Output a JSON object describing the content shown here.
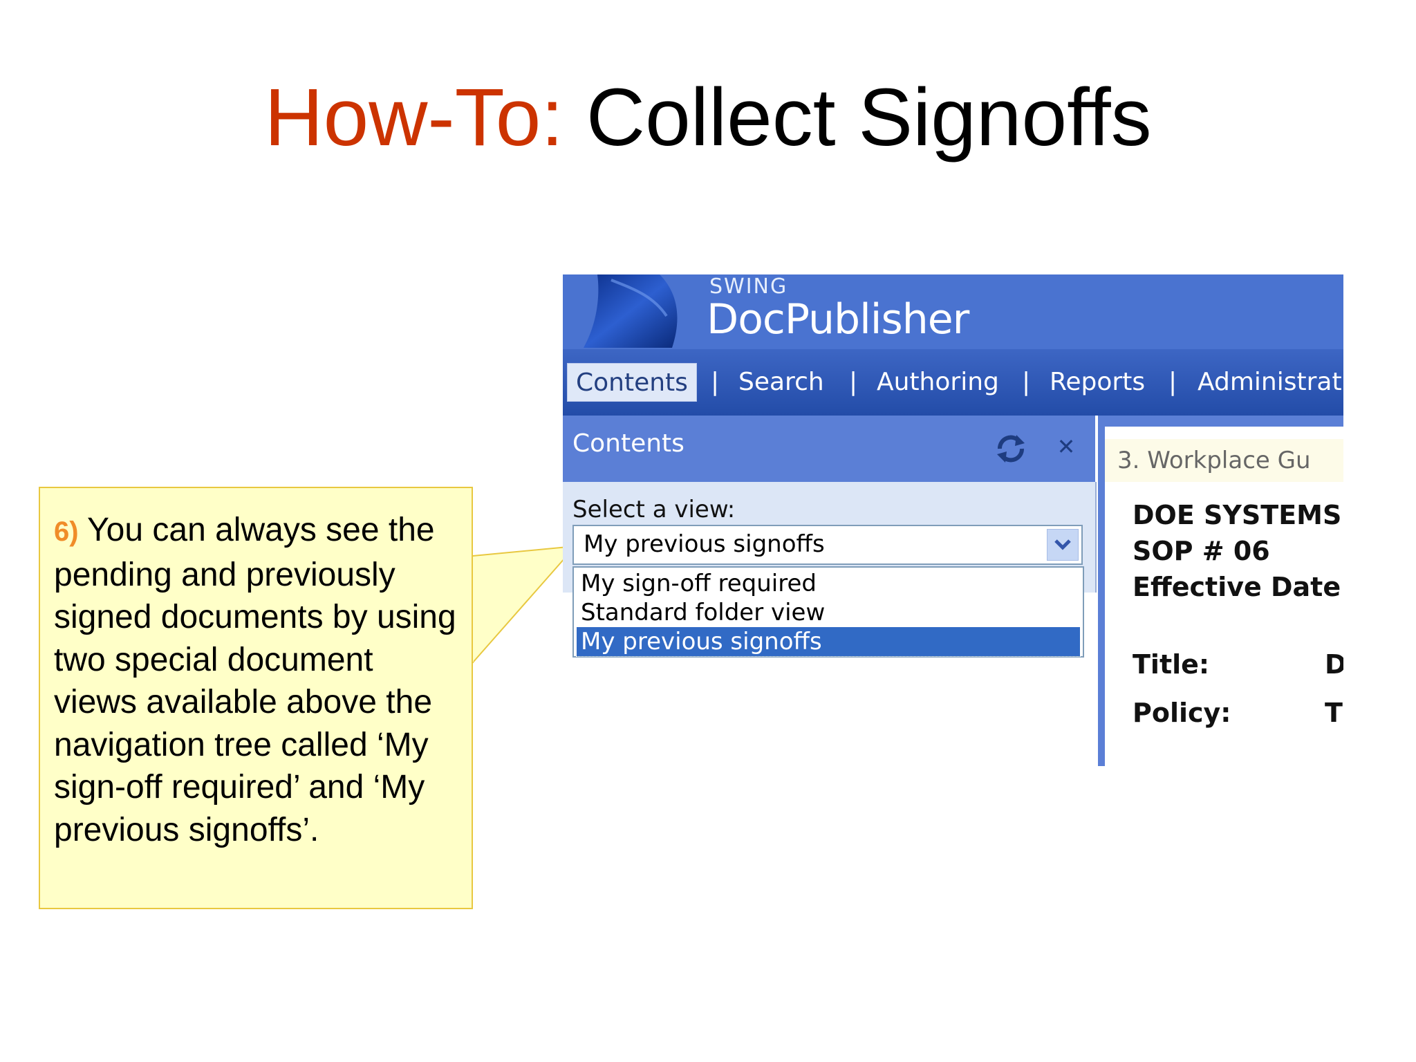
{
  "slide": {
    "title_prefix": "How-To:",
    "title_main": " Collect Signoffs"
  },
  "callout": {
    "step_number": "6)",
    "text": " You can always see the pending and previously signed documents by using two special document views available above the navigation tree called ‘My sign-off required’ and ‘My previous signoffs’."
  },
  "app": {
    "brand_small": "SWING",
    "brand_name": "DocPublisher",
    "nav": [
      {
        "label": "Contents"
      },
      {
        "label": "Search"
      },
      {
        "label": "Authoring"
      },
      {
        "label": "Reports"
      },
      {
        "label": "Administrat"
      }
    ],
    "nav_separator": "|",
    "panel": {
      "title": "Contents",
      "icons": [
        "refresh-icon",
        "close-icon"
      ],
      "close_glyph": "✕",
      "select_label": "Select a view:",
      "select_value": "My previous signoffs",
      "options": [
        {
          "label": "My sign-off required",
          "selected": false
        },
        {
          "label": "Standard folder view",
          "selected": false
        },
        {
          "label": "My previous signoffs",
          "selected": true
        }
      ]
    },
    "document": {
      "breadcrumb": "3. Workplace Gu",
      "line1": "DOE SYSTEMS",
      "line2": "SOP # 06",
      "line3": "Effective Date:",
      "title_label": "Title:",
      "title_value": "D",
      "policy_label": "Policy:",
      "policy_value": "T"
    },
    "colors": {
      "header": "#4a73d0",
      "nav": "#234ca8",
      "selected_option": "#316ac5",
      "title_accent": "#cc3300",
      "callout_bg": "#ffffc8",
      "callout_number": "#f08c28"
    }
  }
}
